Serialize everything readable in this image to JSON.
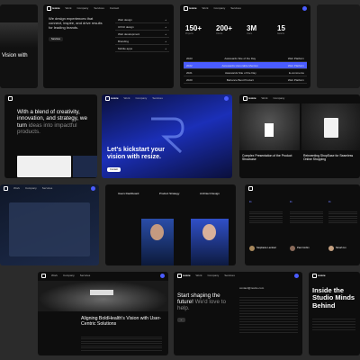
{
  "cards": {
    "c1": {
      "title": "Vision with"
    },
    "c2": {
      "hero": "We design experiences that connect, inspire, and drive results for leading brands.",
      "link": "Services",
      "list": [
        "Web design",
        "UX/UI design",
        "Web development",
        "Branding",
        "Mobile apps"
      ]
    },
    "c3": {
      "stats": [
        {
          "v": "150+",
          "l": "Projects"
        },
        {
          "v": "200+",
          "l": "Clients"
        },
        {
          "v": "3M",
          "l": "Users"
        },
        {
          "v": "15",
          "l": "Awards"
        }
      ],
      "rows": [
        [
          "2023",
          "Awwwards Site of the Day",
          "Web Platform"
        ],
        [
          "2022",
          "Awwwards Honorable Mention",
          "Web Platform"
        ],
        [
          "2021",
          "Awwwards Site of the Day",
          "E-commerce"
        ],
        [
          "2020",
          "Behance Best Product",
          "Web Platform"
        ]
      ]
    },
    "c4": {
      "headline_a": "With a blend of creativity, innovation, and strategy, we turn ",
      "headline_b": "ideas into impactful products."
    },
    "c5": {
      "headline": "Let's kickstart your vision with resize.",
      "button": "Contact"
    },
    "c6": {
      "caption1": "Complex Presentation of the Product Showcase",
      "caption2": "Reinventing ShopEase for Seamless Online Shopping"
    },
    "c8": {
      "tabs": [
        "Users Dashboard",
        "Product Strategy",
        "Architect Design"
      ]
    },
    "c9": {
      "names": [
        "Stephanie Lambert",
        "Paul Corbin",
        "Nimah Lin"
      ],
      "quote": "“"
    },
    "c10": {
      "headline": "Aligning BoldHealth's Vision with User-Centric Solutions"
    },
    "c11": {
      "headline_a": "Start shaping the future! ",
      "headline_b": "We'd love to help.",
      "email": "contact@resize.com"
    },
    "c12": {
      "headline": "Inside the Studio Minds Behind"
    },
    "nav": {
      "brand": "resize",
      "links": [
        "Work",
        "Company",
        "Services",
        "Contact"
      ]
    }
  }
}
